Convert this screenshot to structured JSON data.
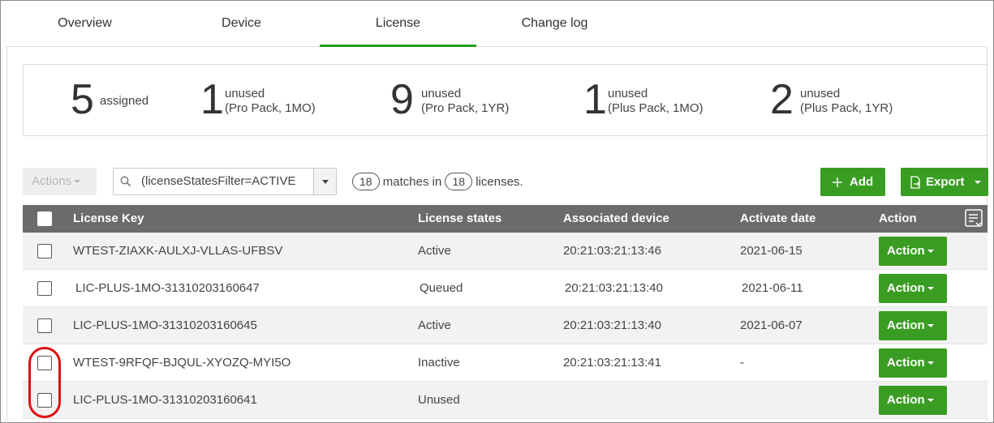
{
  "tabs": [
    {
      "label": "Overview",
      "active": false
    },
    {
      "label": "Device",
      "active": false
    },
    {
      "label": "License",
      "active": true
    },
    {
      "label": "Change log",
      "active": false
    }
  ],
  "summary": [
    {
      "count": "5",
      "label1": "assigned",
      "label2": ""
    },
    {
      "count": "1",
      "label1": "unused",
      "label2": "(Pro Pack, 1MO)"
    },
    {
      "count": "9",
      "label1": "unused",
      "label2": "(Pro Pack, 1YR)"
    },
    {
      "count": "1",
      "label1": "unused",
      "label2": "(Plus Pack, 1MO)"
    },
    {
      "count": "2",
      "label1": "unused",
      "label2": "(Plus Pack, 1YR)"
    }
  ],
  "toolbar": {
    "actions_label": "Actions",
    "search_value": "(licenseStatesFilter=ACTIVE",
    "matches_count": "18",
    "matches_text": "matches in",
    "total_count": "18",
    "licenses_text": "licenses.",
    "add_label": "Add",
    "export_label": "Export"
  },
  "table": {
    "headers": {
      "license_key": "License Key",
      "license_states": "License states",
      "associated_device": "Associated device",
      "activate_date": "Activate date",
      "action": "Action"
    },
    "rows": [
      {
        "key": "WTEST-ZIAXK-AULXJ-VLLAS-UFBSV",
        "state": "Active",
        "device": "20:21:03:21:13:46",
        "date": "2021-06-15",
        "action": "Action"
      },
      {
        "key": "LIC-PLUS-1MO-31310203160647",
        "state": "Queued",
        "device": "20:21:03:21:13:40",
        "date": "2021-06-11",
        "action": "Action"
      },
      {
        "key": "LIC-PLUS-1MO-31310203160645",
        "state": "Active",
        "device": "20:21:03:21:13:40",
        "date": "2021-06-07",
        "action": "Action"
      },
      {
        "key": "WTEST-9RFQF-BJQUL-XYOZQ-MYI5O",
        "state": "Inactive",
        "device": "20:21:03:21:13:41",
        "date": "-",
        "action": "Action"
      },
      {
        "key": "LIC-PLUS-1MO-31310203160641",
        "state": "Unused",
        "device": "",
        "date": "",
        "action": "Action"
      }
    ]
  },
  "colors": {
    "accent_green": "#3a9d23",
    "header_grey": "#6b6b6b",
    "highlight_red": "#e01010"
  }
}
